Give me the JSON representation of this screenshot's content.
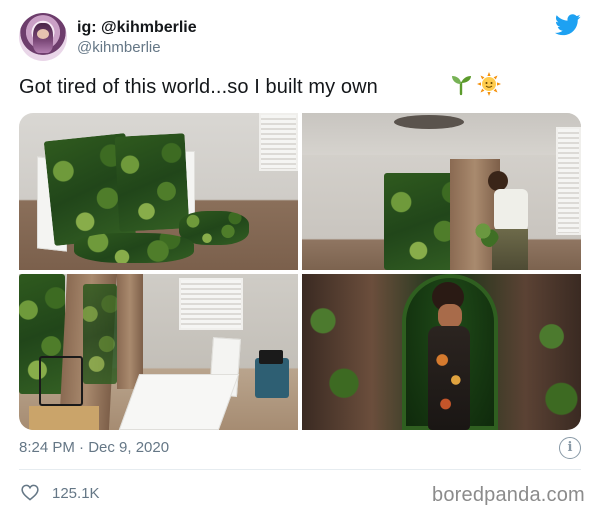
{
  "author": {
    "display_name": "ig: @kihmberlie",
    "handle": "@kihmberlie"
  },
  "icons": {
    "platform": "twitter-bird-icon",
    "emoji_1": "seedling-emoji",
    "emoji_2": "sun-with-face-emoji",
    "info": "info-icon",
    "like": "heart-icon"
  },
  "tweet": {
    "text": "Got tired of this world...so I built my own",
    "timestamp": "8:24 PM · Dec 9, 2020",
    "info_glyph": "i"
  },
  "media": {
    "photo_count": 4,
    "photos": [
      {
        "subject": "moss panels on carpet"
      },
      {
        "subject": "person installing moss wall"
      },
      {
        "subject": "room with wooden boards and window"
      },
      {
        "subject": "woman posing in green arch"
      }
    ]
  },
  "stats": {
    "likes": "125.1K"
  },
  "watermark": "boredpanda.com",
  "colors": {
    "twitter_blue": "#1da1f2",
    "secondary_text": "#657786",
    "primary_text": "#14171a",
    "divider": "#e6ecf0"
  }
}
